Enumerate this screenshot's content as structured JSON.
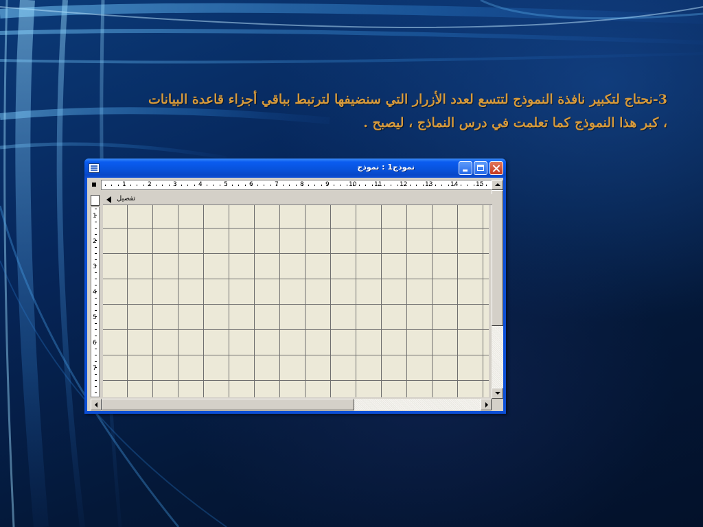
{
  "slide": {
    "line1": "3-نحتاج لتكبير نافذة النموذج لتتسع لعدد الأزرار التي سنضيفها لترتبط بباقي أجزاء قاعدة البيانات",
    "line2": "، كبر هذا النموذج كما تعلمت في درس النماذج ، ليصبح ."
  },
  "window": {
    "title": "نموذج1 : نموذج",
    "icons": {
      "system": "form-icon",
      "minimize": "minimize-icon",
      "maximize": "maximize-icon",
      "close": "close-icon"
    }
  },
  "designer": {
    "section_label": "تفصيل",
    "horizontal_ruler": [
      "1",
      "2",
      "3",
      "4",
      "5",
      "6",
      "7",
      "8",
      "9",
      "10",
      "11",
      "12",
      "13",
      "14",
      "15"
    ],
    "vertical_ruler": [
      "1",
      "2",
      "3",
      "4",
      "5",
      "6",
      "7"
    ]
  }
}
